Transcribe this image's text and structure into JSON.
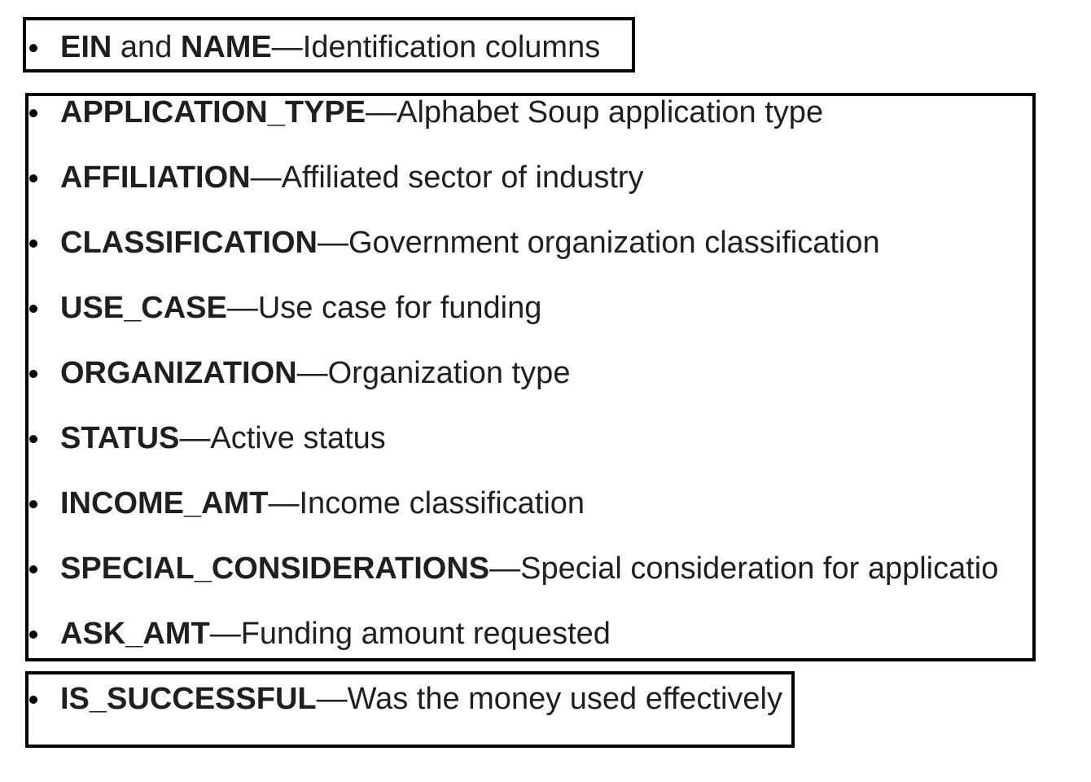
{
  "items": [
    {
      "term_a": "EIN",
      "joiner": "and",
      "term_b": "NAME",
      "dash": "—",
      "desc": "Identification columns"
    },
    {
      "term": "APPLICATION_TYPE",
      "dash": "—",
      "desc": "Alphabet Soup application type"
    },
    {
      "term": "AFFILIATION",
      "dash": "—",
      "desc": "Affiliated sector of industry"
    },
    {
      "term": "CLASSIFICATION",
      "dash": "—",
      "desc": "Government organization classification"
    },
    {
      "term": "USE_CASE",
      "dash": "—",
      "desc": "Use case for funding"
    },
    {
      "term": "ORGANIZATION",
      "dash": "—",
      "desc": "Organization type"
    },
    {
      "term": "STATUS",
      "dash": "—",
      "desc": "Active status"
    },
    {
      "term": "INCOME_AMT",
      "dash": "—",
      "desc": "Income classification"
    },
    {
      "term": "SPECIAL_CONSIDERATIONS",
      "dash": "—",
      "desc": "Special consideration for applicatio"
    },
    {
      "term": "ASK_AMT",
      "dash": "—",
      "desc": "Funding amount requested"
    },
    {
      "term": "IS_SUCCESSFUL",
      "dash": "—",
      "desc": "Was the money used effectively"
    }
  ]
}
